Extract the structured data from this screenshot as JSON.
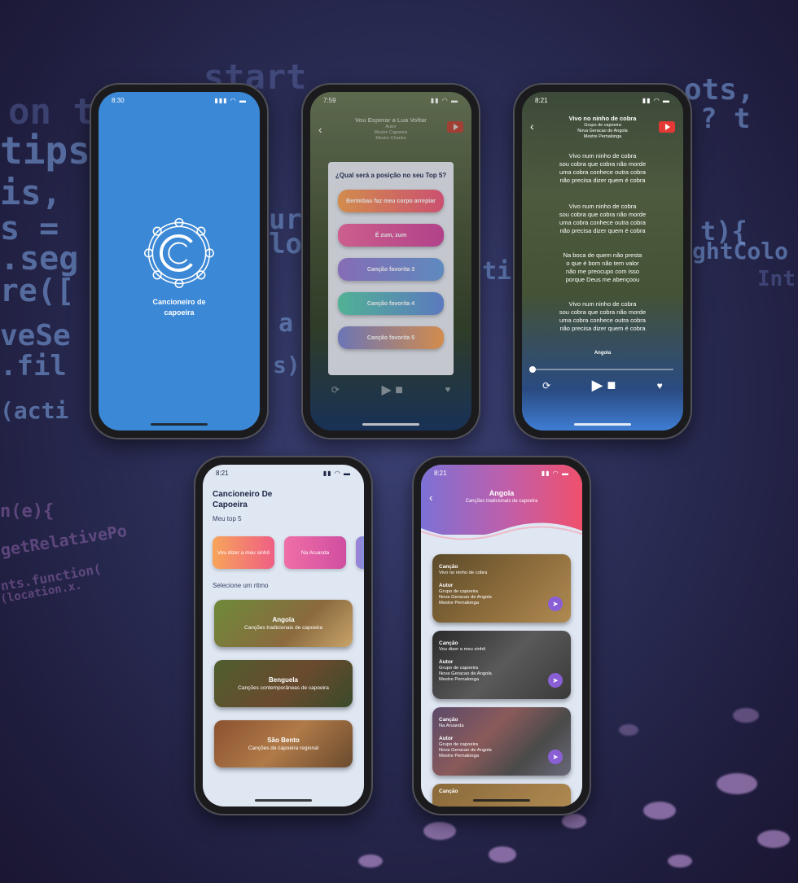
{
  "code_fragments": [
    "on th",
    "start",
    "tips",
    "ots,",
    "is,",
    "? t",
    "s =",
    "ur",
    ".seg",
    "lo",
    "t){",
    "re([",
    "ghtColo",
    "a",
    "veSe",
    "ti",
    ".fil",
    "s)",
    "(acti",
    "n(e){",
    "getRelativePo",
    "nts.function(",
    "(location.x.",
    "Int"
  ],
  "splash": {
    "time": "8:30",
    "title_line1": "Cancioneiro de",
    "title_line2": "capoeira"
  },
  "player_modal": {
    "time": "7:59",
    "song_title": "Vou Esperar a Lua Voltar",
    "author_label": "Autor",
    "author_lines": [
      "Mestre Capoeira",
      "Mestre Charles"
    ],
    "question": "¿Qual será a posição no seu Top 5?",
    "options": [
      {
        "label": "Berimbau faz meu corpo arrepiar",
        "from": "#f7a45a",
        "to": "#ef5f84"
      },
      {
        "label": "É zum, zum",
        "from": "#ef6fa6",
        "to": "#d04ea1"
      },
      {
        "label": "Canção favorita 3",
        "from": "#9d7fd6",
        "to": "#6fa2df"
      },
      {
        "label": "Canção favorita 4",
        "from": "#5fd0b0",
        "to": "#6c8fe0"
      },
      {
        "label": "Canção favorita 5",
        "from": "#7f8ad6",
        "to": "#f7a45a"
      }
    ]
  },
  "player_lyrics": {
    "time": "8:21",
    "song_title": "Vivo no ninho de cobra",
    "group": "Grupo de capoeira",
    "group_name": "Nova Geracao de Angola",
    "master": "Mestre Pernalonga",
    "stanzas": [
      [
        "Vivo num ninho de cobra",
        "sou cobra que cobra não morde",
        "uma cobra conhece outra cobra",
        "não precisa dizer quem é cobra"
      ],
      [
        "Vivo num ninho de cobra",
        "sou cobra que cobra não morde",
        "uma cobra conhece outra cobra",
        "não precisa dizer quem é cobra"
      ],
      [
        "Na boca de quem não presta",
        "o que é bom não tem valor",
        "não me preocupo com isso",
        "porque Deus me abençoou"
      ],
      [
        "Vivo num ninho de cobra",
        "sou cobra que cobra não morde",
        "uma cobra conhece outra cobra",
        "não precisa dizer quem é cobra"
      ]
    ],
    "rhythm": "Angola",
    "progress": 0.02
  },
  "home": {
    "time": "8:21",
    "title_line1": "Cancioneiro De",
    "title_line2": "Capoeira",
    "top5_label": "Meu top 5",
    "top5": [
      {
        "label": "Vou dizer a meu sinhô",
        "from": "#f7a45a",
        "to": "#ef5f84"
      },
      {
        "label": "Na Aruanda",
        "from": "#ef6fa6",
        "to": "#d04ea1"
      }
    ],
    "rhythm_label": "Selecione um ritmo",
    "rhythms": [
      {
        "title": "Angola",
        "subtitle": "Canções tradicionais de capoeira",
        "color": "#7a6a42"
      },
      {
        "title": "Benguela",
        "subtitle": "Canções contemporâneas de capoeira",
        "color": "#5b4a2e"
      },
      {
        "title": "São Bento",
        "subtitle": "Canções de capoeira regional",
        "color": "#8a5a2e"
      }
    ]
  },
  "angola": {
    "time": "8:21",
    "title": "Angola",
    "subtitle": "Canções tradicionais de capoeira",
    "song_label": "Canção",
    "author_label": "Autor",
    "songs": [
      {
        "song": "Vivo no ninho de cobra",
        "group": "Grupo de capoeira",
        "group_name": "Nova Geracao de Angola",
        "master": "Mestre Pernalonga",
        "color": "#7b6238"
      },
      {
        "song": "Vou dizer a meu sinhô",
        "group": "Grupo de capoeira",
        "group_name": "Nova Geracao de Angola",
        "master": "Mestre Pernalonga",
        "color": "#3a3a3a"
      },
      {
        "song": "Na Aruanda",
        "group": "Grupo de capoeira",
        "group_name": "Nova Geracao de Angola",
        "master": "Mestre Pernalonga",
        "color": "#6a5a62"
      }
    ],
    "partial_label": "Canção"
  },
  "colors": {
    "splash_bg": "#3b88d6",
    "accent_purple": "#8a5fd6",
    "light_bg": "#dfe7f3"
  }
}
